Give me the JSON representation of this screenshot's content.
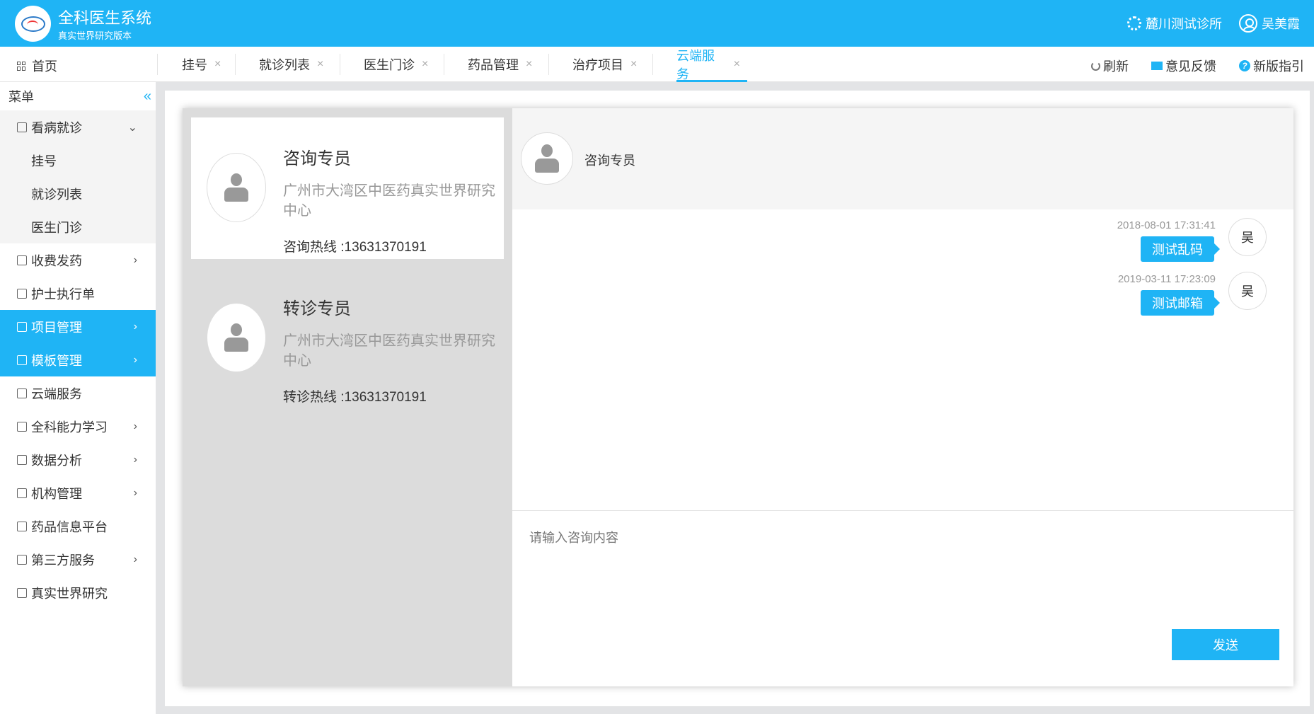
{
  "app": {
    "title": "全科医生系统",
    "subtitle": "真实世界研究版本",
    "clinic": "麓川测试诊所",
    "user": "吴美霞"
  },
  "tabs": {
    "home": "首页",
    "items": [
      {
        "label": "挂号"
      },
      {
        "label": "就诊列表"
      },
      {
        "label": "医生门诊"
      },
      {
        "label": "药品管理"
      },
      {
        "label": "治疗项目"
      },
      {
        "label": "云端服务",
        "active": true
      }
    ],
    "close_icon": "×",
    "actions": {
      "refresh": "刷新",
      "feedback": "意见反馈",
      "guide": "新版指引"
    }
  },
  "sidebar": {
    "title": "菜单",
    "items": [
      {
        "label": "看病就诊",
        "icon": "clinic-icon",
        "expanded": true
      },
      {
        "label": "挂号",
        "sub": true
      },
      {
        "label": "就诊列表",
        "sub": true
      },
      {
        "label": "医生门诊",
        "sub": true
      },
      {
        "label": "收费发药",
        "icon": "cart-icon"
      },
      {
        "label": "护士执行单",
        "icon": "document-icon"
      },
      {
        "label": "项目管理",
        "icon": "project-icon",
        "highlight": true
      },
      {
        "label": "模板管理",
        "icon": "template-icon",
        "highlight": true
      },
      {
        "label": "云端服务",
        "icon": "cloud-icon"
      },
      {
        "label": "全科能力学习",
        "icon": "learning-icon"
      },
      {
        "label": "数据分析",
        "icon": "chart-icon"
      },
      {
        "label": "机构管理",
        "icon": "flag-icon"
      },
      {
        "label": "药品信息平台",
        "icon": "medicine-icon"
      },
      {
        "label": "第三方服务",
        "icon": "thirdparty-icon"
      },
      {
        "label": "真实世界研究",
        "icon": "globe-icon"
      }
    ]
  },
  "contacts": [
    {
      "name": "咨询专员",
      "org": "广州市大湾区中医药真实世界研究中心",
      "phone": "咨询热线 :13631370191"
    },
    {
      "name": "转诊专员",
      "org": "广州市大湾区中医药真实世界研究中心",
      "phone": "转诊热线 :13631370191"
    }
  ],
  "chat": {
    "header_name": "咨询专员",
    "messages": [
      {
        "time": "2018-08-01 17:31:41",
        "text": "测试乱码",
        "avatar": "吴"
      },
      {
        "time": "2019-03-11 17:23:09",
        "text": "测试邮箱",
        "avatar": "吴"
      }
    ],
    "input_placeholder": "请输入咨询内容",
    "send_label": "发送"
  },
  "colors": {
    "primary": "#1fb4f5",
    "content_bg": "#e3e4e6",
    "contact_list_bg": "#dcdcdc"
  }
}
